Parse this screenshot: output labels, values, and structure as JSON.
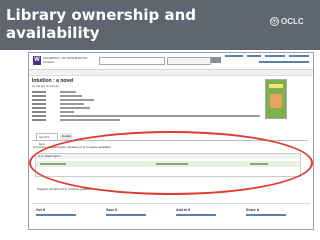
{
  "slide": {
    "title": "Library ownership and availability"
  },
  "logo": {
    "label": "OCLC",
    "symbol": "⦿"
  },
  "colors": {
    "header_bg": "#5f6670",
    "accent_red": "#e23a2f",
    "uw_purple": "#4b2e83"
  },
  "uw": {
    "logo_glyph": "W",
    "logo_line1": "UNIVERSITY OF WASHINGTON",
    "logo_line2": "Libraries"
  },
  "record": {
    "title": "Intuition : a novel",
    "author": "by Allegra Goodman"
  },
  "tabs": [
    {
      "label": "Get this item"
    },
    {
      "label": "Details"
    }
  ],
  "holdings": {
    "title": "University of Washington Libraries (4 of 4 copies available)",
    "location_header": "U.S. Washington",
    "outlined_note": "Suggest Libraries (4 of 4 copies available)"
  },
  "bottom_panels": [
    {
      "heading": "Get it"
    },
    {
      "heading": "Save it"
    },
    {
      "heading": "Add to it"
    },
    {
      "heading": "Share it"
    }
  ]
}
